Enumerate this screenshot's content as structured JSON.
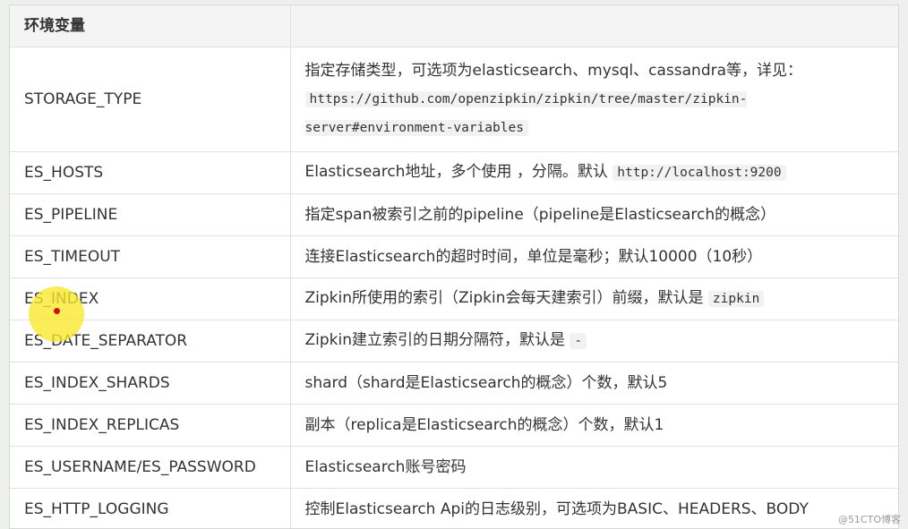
{
  "table": {
    "header": [
      "环境变量",
      ""
    ],
    "rows": [
      {
        "key": "STORAGE_TYPE",
        "desc": "指定存储类型，可选项为elasticsearch、mysql、cassandra等，详见：",
        "code": "https://github.com/openzipkin/zipkin/tree/master/zipkin-server#environment-variables",
        "suffix": ""
      },
      {
        "key": "ES_HOSTS",
        "desc": "Elasticsearch地址，多个使用 ，分隔。默认 ",
        "code": "http://localhost:9200",
        "suffix": ""
      },
      {
        "key": "ES_PIPELINE",
        "desc": "指定span被索引之前的pipeline（pipeline是Elasticsearch的概念）",
        "code": "",
        "suffix": ""
      },
      {
        "key": "ES_TIMEOUT",
        "desc": "连接Elasticsearch的超时时间，单位是毫秒；默认10000（10秒）",
        "code": "",
        "suffix": ""
      },
      {
        "key": "ES_INDEX",
        "desc": "Zipkin所使用的索引（Zipkin会每天建索引）前缀，默认是 ",
        "code": "zipkin",
        "suffix": ""
      },
      {
        "key": "ES_DATE_SEPARATOR",
        "desc": "Zipkin建立索引的日期分隔符，默认是 ",
        "code": "-",
        "suffix": ""
      },
      {
        "key": "ES_INDEX_SHARDS",
        "desc": "shard（shard是Elasticsearch的概念）个数，默认5",
        "code": "",
        "suffix": ""
      },
      {
        "key": "ES_INDEX_REPLICAS",
        "desc": "副本（replica是Elasticsearch的概念）个数，默认1",
        "code": "",
        "suffix": ""
      },
      {
        "key": "ES_USERNAME/ES_PASSWORD",
        "desc": "Elasticsearch账号密码",
        "code": "",
        "suffix": ""
      },
      {
        "key": "ES_HTTP_LOGGING",
        "desc": "控制Elasticsearch Api的日志级别，可选项为BASIC、HEADERS、BODY",
        "code": "",
        "suffix": ""
      }
    ]
  },
  "watermark": "@51CTO博客"
}
